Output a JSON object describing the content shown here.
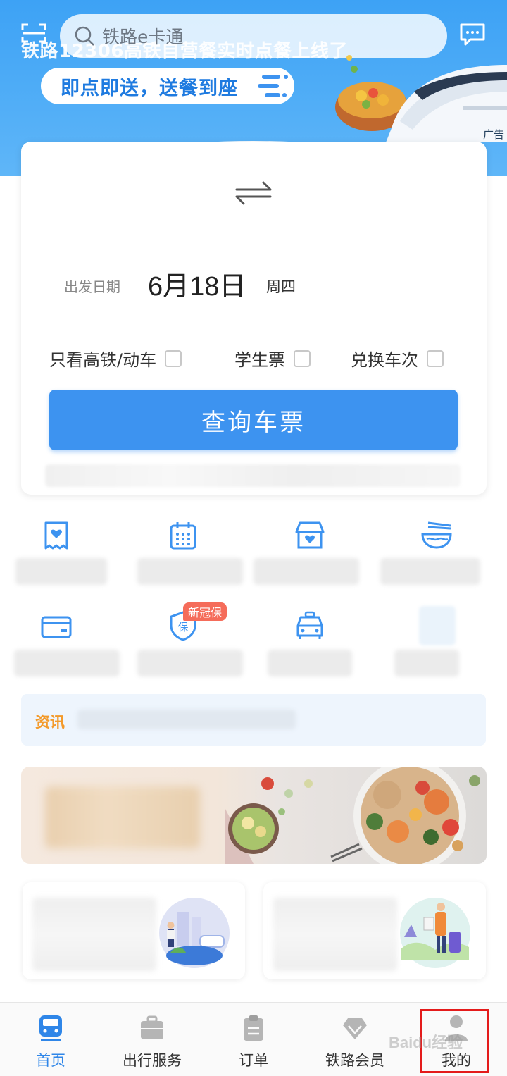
{
  "header": {
    "search_placeholder": "铁路e卡通",
    "ad_headline": "铁路12306高铁自营餐实时点餐上线了",
    "ad_pill": "即点即送，送餐到座",
    "ad_tag": "广告"
  },
  "ticket": {
    "date_label": "出发日期",
    "date_value": "6月18日",
    "weekday": "周四",
    "options": [
      {
        "label": "只看高铁/动车",
        "checked": false
      },
      {
        "label": "学生票",
        "checked": false
      },
      {
        "label": "兑换车次",
        "checked": false
      }
    ],
    "query_button": "查询车票"
  },
  "services": {
    "row1_icons": [
      "ticket-heart-icon",
      "calendar-icon",
      "shop-icon",
      "noodle-bowl-icon"
    ],
    "row2_icons": [
      "card-icon",
      "insurance-shield-icon",
      "car-icon",
      "blurred-icon"
    ],
    "insurance_badge": "新冠保",
    "insurance_icon_text": "保"
  },
  "news": {
    "label": "资讯"
  },
  "tabbar": {
    "items": [
      {
        "label": "首页",
        "icon": "train-icon",
        "active": true
      },
      {
        "label": "出行服务",
        "icon": "briefcase-icon",
        "active": false
      },
      {
        "label": "订单",
        "icon": "clipboard-icon",
        "active": false
      },
      {
        "label": "铁路会员",
        "icon": "diamond-icon",
        "active": false
      },
      {
        "label": "我的",
        "icon": "user-icon",
        "active": false
      }
    ]
  },
  "watermark": "Baidu经验",
  "colors": {
    "primary": "#3d93f0",
    "accent": "#f39a2b",
    "badge": "#f56c5a",
    "highlight": "#e41b1b"
  }
}
